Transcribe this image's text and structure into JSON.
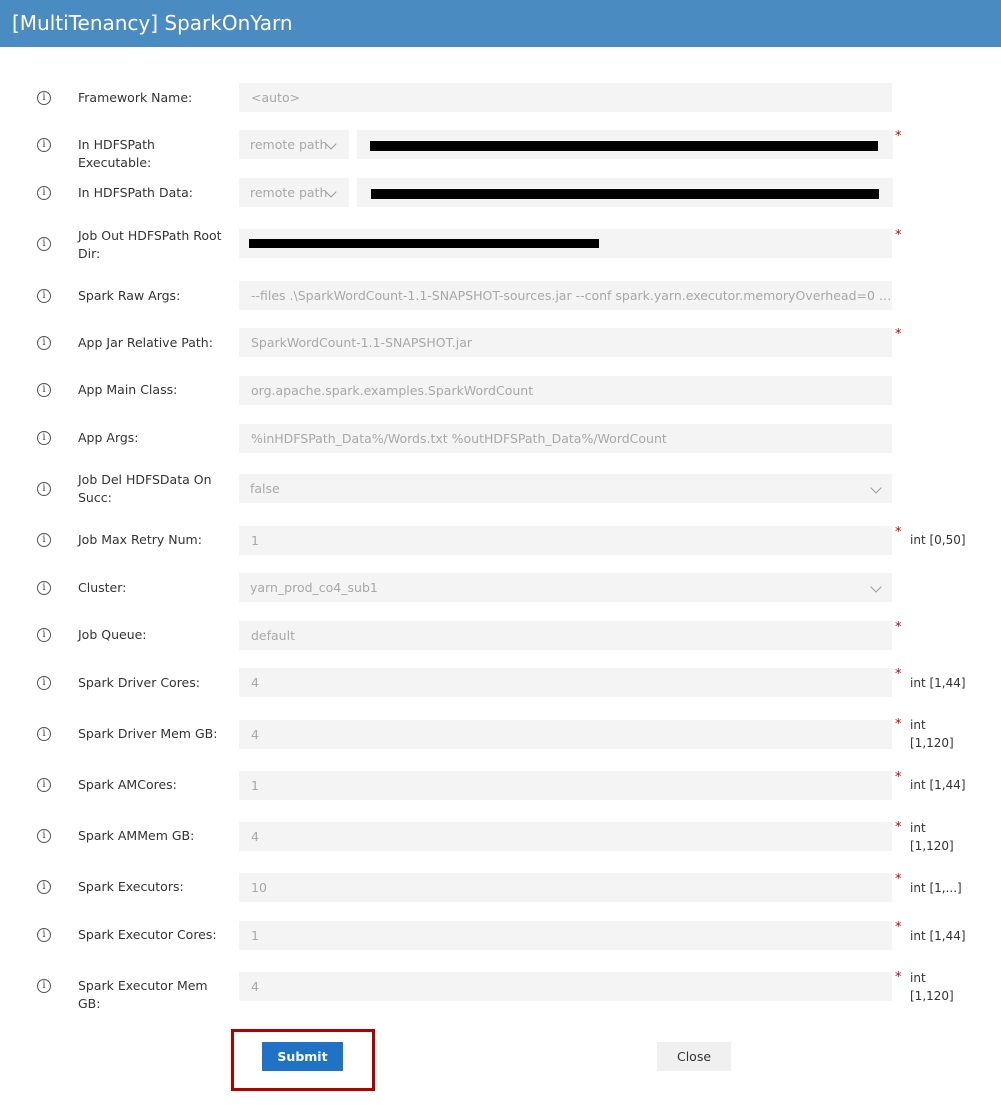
{
  "window": {
    "title": "[MultiTenancy] SparkOnYarn"
  },
  "form": {
    "framework_name": {
      "label": "Framework Name:",
      "value": "<auto>"
    },
    "in_hdfs_exec": {
      "label": "In HDFSPath Executable:",
      "type_value": "remote path"
    },
    "in_hdfs_data": {
      "label": "In HDFSPath Data:",
      "type_value": "remote path"
    },
    "job_out_root": {
      "label": "Job Out HDFSPath Root Dir:"
    },
    "spark_raw_args": {
      "label": "Spark Raw Args:",
      "value": "--files .\\SparkWordCount-1.1-SNAPSHOT-sources.jar --conf spark.yarn.executor.memoryOverhead=0 --conf s..."
    },
    "app_jar_path": {
      "label": "App Jar Relative Path:",
      "value": "SparkWordCount-1.1-SNAPSHOT.jar"
    },
    "app_main_class": {
      "label": "App Main Class:",
      "value": "org.apache.spark.examples.SparkWordCount"
    },
    "app_args": {
      "label": "App Args:",
      "value": "%inHDFSPath_Data%/Words.txt %outHDFSPath_Data%/WordCount"
    },
    "job_del_data": {
      "label": "Job Del HDFSData On Succ:",
      "value": "false"
    },
    "job_max_retry": {
      "label": "Job Max Retry Num:",
      "value": "1",
      "hint": "int [0,50]"
    },
    "cluster": {
      "label": "Cluster:",
      "value": "yarn_prod_co4_sub1"
    },
    "job_queue": {
      "label": "Job Queue:",
      "value": "default"
    },
    "driver_cores": {
      "label": "Spark Driver Cores:",
      "value": "4",
      "hint": "int [1,44]"
    },
    "driver_mem": {
      "label": "Spark Driver Mem GB:",
      "value": "4",
      "hint": "int [1,120]"
    },
    "am_cores": {
      "label": "Spark AMCores:",
      "value": "1",
      "hint": "int [1,44]"
    },
    "am_mem": {
      "label": "Spark AMMem GB:",
      "value": "4",
      "hint": "int [1,120]"
    },
    "executors": {
      "label": "Spark Executors:",
      "value": "10",
      "hint": "int [1,...]"
    },
    "executor_cores": {
      "label": "Spark Executor Cores:",
      "value": "1",
      "hint": "int [1,44]"
    },
    "executor_mem": {
      "label": "Spark Executor Mem GB:",
      "value": "4",
      "hint": "int [1,120]"
    },
    "required_mark": "*",
    "info_glyph": "i"
  },
  "buttons": {
    "submit": "Submit",
    "close": "Close"
  },
  "colors": {
    "title_bar": "#4a8bc2",
    "submit": "#1f72c4",
    "highlight": "#b00000",
    "required": "#c00000"
  },
  "icons": {
    "info": "info-circle-icon",
    "dropdown": "chevron-down-icon"
  }
}
